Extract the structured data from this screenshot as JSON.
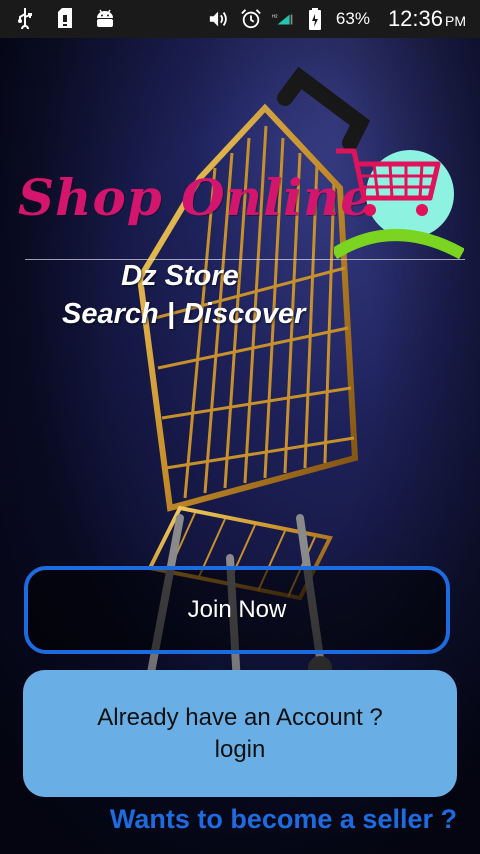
{
  "status_bar": {
    "battery_percent": "63%",
    "time": "12:36",
    "ampm": "PM",
    "icons": [
      "usb-icon",
      "sd-card-icon",
      "android-icon",
      "volume-icon",
      "alarm-icon",
      "signal-icon",
      "battery-icon"
    ]
  },
  "header": {
    "logo_text": "Shop Online",
    "store_name": "Dz Store",
    "tagline": "Search | Discover"
  },
  "actions": {
    "join_label": "Join Now",
    "login_line1": "Already have an Account ?",
    "login_line2": "login",
    "seller_link": "Wants to become a seller ?"
  },
  "colors": {
    "logo_pink": "#d3156d",
    "accent_blue": "#1e6be0",
    "login_bg": "#6aaee6",
    "badge_bg": "#8ef2e0",
    "badge_swoosh": "#7bd41f"
  }
}
